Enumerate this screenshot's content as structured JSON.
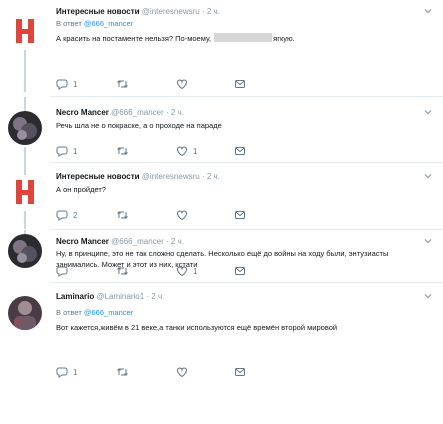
{
  "tweets": [
    {
      "name": "Интересные новости",
      "handle": "@interesnewsru",
      "time": "· 2 ч.",
      "reply_prefix": "В ответ",
      "reply_to": "@666_mancer",
      "text_a": "А красить на постаменте нельзя? По-моему,",
      "text_b": "ягкую.",
      "stats": {
        "replies": "1",
        "retweets": "",
        "likes": ""
      }
    },
    {
      "name": "Necro Mancer",
      "handle": "@666_mancer",
      "time": "· 2 ч.",
      "text": "Речь шла не о покраске, а о проходе на параде",
      "stats": {
        "replies": "1",
        "retweets": "",
        "likes": "1"
      }
    },
    {
      "name": "Интересные новости",
      "handle": "@interesnewsru",
      "time": "· 2 ч.",
      "text": "А он пройдет?",
      "stats": {
        "replies": "2",
        "retweets": "",
        "likes": ""
      }
    },
    {
      "name": "Necro Mancer",
      "handle": "@666_mancer",
      "time": "· 2 ч.",
      "text": "Ну, в принципе, это не так сложно сделать. Несколько ещё до войны на ходу были, энтузиасты занимались. Может и этот из них, кстати",
      "stats": {
        "replies": "",
        "retweets": "",
        "likes": "1"
      }
    },
    {
      "name": "Laminario",
      "handle": "@Laminario1",
      "time": "· 2 ч.",
      "reply_prefix": "В ответ",
      "reply_to": "@666_mancer",
      "text": "Вот кажется,живём в 21 веке,а танки используются ещё времён второй мировой",
      "stats": {
        "replies": "1",
        "retweets": "",
        "likes": ""
      }
    }
  ],
  "colors": {
    "accent": "#1b95e0",
    "icon": "#657786",
    "line": "#ccd6dd"
  }
}
